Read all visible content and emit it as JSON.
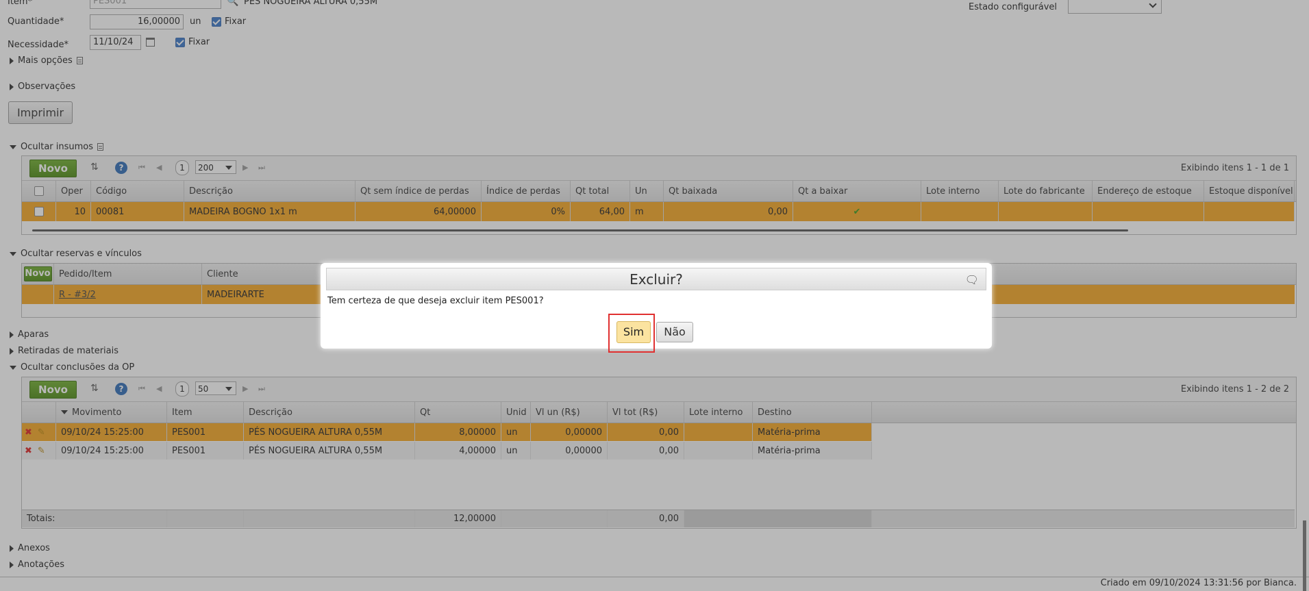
{
  "form": {
    "item_label": "Item*",
    "item_value": "PES001",
    "item_desc": "PÉS NOGUEIRA ALTURA 0,55M",
    "qty_label": "Quantidade*",
    "qty_value": "16,00000",
    "qty_unit": "un",
    "qty_fix": "Fixar",
    "need_label": "Necessidade*",
    "need_value": "11/10/24",
    "need_fix": "Fixar",
    "state_label": "Estado configurável",
    "more_options": "Mais opções",
    "observations": "Observações",
    "print_button": "Imprimir"
  },
  "insumos": {
    "section_title": "Ocultar insumos",
    "new_button": "Novo",
    "page": "1",
    "page_size": "200",
    "showing": "Exibindo itens 1 - 1 de 1",
    "columns": [
      "Oper",
      "Código",
      "Descrição",
      "Qt sem índice de perdas",
      "Índice de perdas",
      "Qt total",
      "Un",
      "Qt baixada",
      "Qt a baixar",
      "Lote interno",
      "Lote do fabricante",
      "Endereço de estoque",
      "Estoque disponível"
    ],
    "rows": [
      {
        "oper": "10",
        "code": "00081",
        "desc": "MADEIRA BOGNO 1x1 m",
        "qt_sem": "64,00000",
        "indice": "0%",
        "qt_total": "64,00",
        "un": "m",
        "qt_baixada": "0,00"
      }
    ]
  },
  "reservas": {
    "section_title": "Ocultar reservas e vínculos",
    "new_button": "Novo",
    "columns": [
      "Pedido/Item",
      "Cliente"
    ],
    "rows": [
      {
        "pedido": "R - #3/2",
        "cliente": "MADEIRARTE"
      }
    ]
  },
  "sections": {
    "aparas": "Aparas",
    "retiradas": "Retiradas de materiais",
    "conclusoes": "Ocultar conclusões da OP",
    "anexos": "Anexos",
    "anotacoes": "Anotações"
  },
  "conclusoes": {
    "new_button": "Novo",
    "page": "1",
    "page_size": "50",
    "showing": "Exibindo itens 1 - 2 de 2",
    "columns": [
      "Movimento",
      "Item",
      "Descrição",
      "Qt",
      "Unid",
      "Vl un (R$)",
      "Vl tot (R$)",
      "Lote interno",
      "Destino"
    ],
    "rows": [
      {
        "mov": "09/10/24 15:25:00",
        "item": "PES001",
        "desc": "PÉS NOGUEIRA ALTURA 0,55M",
        "qt": "8,00000",
        "unid": "un",
        "vl_un": "0,00000",
        "vl_tot": "0,00",
        "destino": "Matéria-prima"
      },
      {
        "mov": "09/10/24 15:25:00",
        "item": "PES001",
        "desc": "PÉS NOGUEIRA ALTURA 0,55M",
        "qt": "4,00000",
        "unid": "un",
        "vl_un": "0,00000",
        "vl_tot": "0,00",
        "destino": "Matéria-prima"
      }
    ],
    "totals_label": "Totais:",
    "total_qt": "12,00000",
    "total_vl": "0,00"
  },
  "footer": {
    "created": "Criado em 09/10/2024 13:31:56 por Bianca."
  },
  "dialog": {
    "title": "Excluir?",
    "message": "Tem certeza de que deseja excluir item PES001?",
    "yes": "Sim",
    "no": "Não"
  }
}
